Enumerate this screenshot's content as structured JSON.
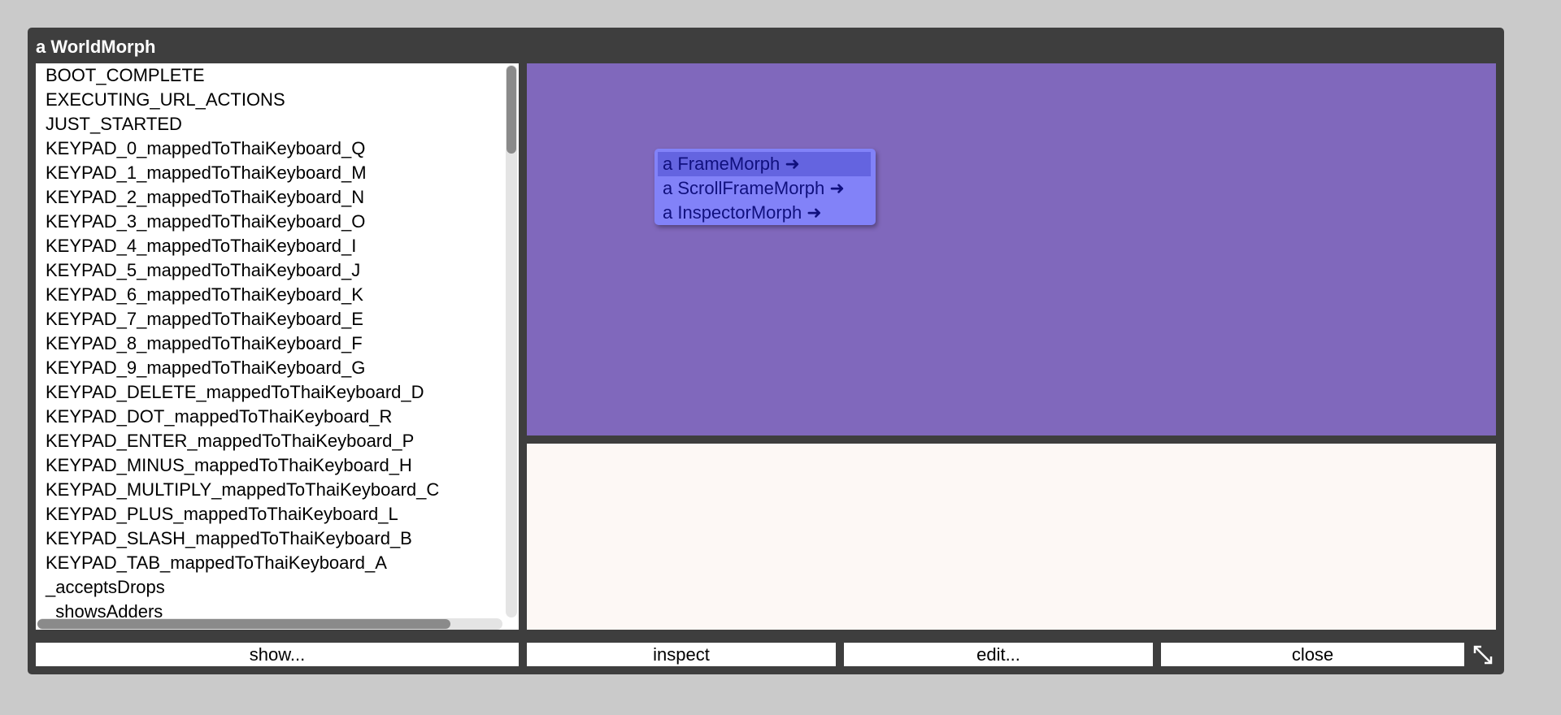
{
  "window": {
    "title": "a WorldMorph"
  },
  "property_list": [
    "BOOT_COMPLETE",
    "EXECUTING_URL_ACTIONS",
    "JUST_STARTED",
    "KEYPAD_0_mappedToThaiKeyboard_Q",
    "KEYPAD_1_mappedToThaiKeyboard_M",
    "KEYPAD_2_mappedToThaiKeyboard_N",
    "KEYPAD_3_mappedToThaiKeyboard_O",
    "KEYPAD_4_mappedToThaiKeyboard_I",
    "KEYPAD_5_mappedToThaiKeyboard_J",
    "KEYPAD_6_mappedToThaiKeyboard_K",
    "KEYPAD_7_mappedToThaiKeyboard_E",
    "KEYPAD_8_mappedToThaiKeyboard_F",
    "KEYPAD_9_mappedToThaiKeyboard_G",
    "KEYPAD_DELETE_mappedToThaiKeyboard_D",
    "KEYPAD_DOT_mappedToThaiKeyboard_R",
    "KEYPAD_ENTER_mappedToThaiKeyboard_P",
    "KEYPAD_MINUS_mappedToThaiKeyboard_H",
    "KEYPAD_MULTIPLY_mappedToThaiKeyboard_C",
    "KEYPAD_PLUS_mappedToThaiKeyboard_L",
    "KEYPAD_SLASH_mappedToThaiKeyboard_B",
    "KEYPAD_TAB_mappedToThaiKeyboard_A",
    "_acceptsDrops",
    "_showsAdders"
  ],
  "popup_menu": {
    "items": [
      "a FrameMorph ➜",
      "a ScrollFrameMorph ➜",
      "a InspectorMorph ➜"
    ]
  },
  "buttons": {
    "show": "show...",
    "inspect": "inspect",
    "edit": "edit...",
    "close": "close"
  },
  "colors": {
    "window_frame": "#3e3e3e",
    "preview_background": "#8068bc",
    "menu_background": "#8282f8",
    "menu_highlight": "#6464e0",
    "menu_text": "#10107e",
    "detail_background": "#fdf8f5"
  },
  "icons": {
    "resize": "resize-diagonal-icon"
  }
}
